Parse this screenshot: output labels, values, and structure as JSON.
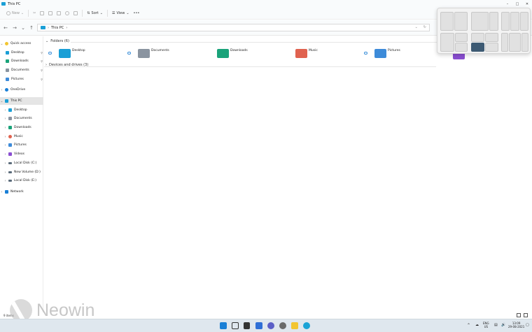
{
  "window": {
    "title": "This PC"
  },
  "toolbar": {
    "new_label": "New",
    "sort_label": "Sort",
    "view_label": "View",
    "more_label": "•••"
  },
  "address": {
    "path": "This PC"
  },
  "sidebar": {
    "items": [
      {
        "label": "Quick access",
        "icon_color": "#f2c531",
        "pinned": false
      },
      {
        "label": "Desktop",
        "icon_color": "#1a9fd6",
        "pinned": true
      },
      {
        "label": "Downloads",
        "icon_color": "#1aa37a",
        "pinned": true
      },
      {
        "label": "Documents",
        "icon_color": "#8a94a0",
        "pinned": true
      },
      {
        "label": "Pictures",
        "icon_color": "#3d8bd9",
        "pinned": true
      },
      {
        "label": "OneDrive",
        "icon_color": "#1a7fd6",
        "pinned": false
      },
      {
        "label": "This PC",
        "icon_color": "#1a9fd6",
        "pinned": false
      },
      {
        "label": "Desktop",
        "icon_color": "#1a9fd6",
        "pinned": false
      },
      {
        "label": "Documents",
        "icon_color": "#8a94a0",
        "pinned": false
      },
      {
        "label": "Downloads",
        "icon_color": "#1aa37a",
        "pinned": false
      },
      {
        "label": "Music",
        "icon_color": "#e0624f",
        "pinned": false
      },
      {
        "label": "Pictures",
        "icon_color": "#3d8bd9",
        "pinned": false
      },
      {
        "label": "Videos",
        "icon_color": "#8a4fd1",
        "pinned": false
      },
      {
        "label": "Local Disk (C:)",
        "icon_color": "#5a6b7a",
        "pinned": false
      },
      {
        "label": "New Volume (D:)",
        "icon_color": "#5a6b7a",
        "pinned": false
      },
      {
        "label": "Local Disk (E:)",
        "icon_color": "#5a6b7a",
        "pinned": false
      },
      {
        "label": "Network",
        "icon_color": "#1a7fd6",
        "pinned": false
      }
    ]
  },
  "content": {
    "folders_header": "Folders (6)",
    "drives_header": "Devices and drives (3)",
    "folders": [
      {
        "label": "Desktop",
        "color": "#1a9fd6"
      },
      {
        "label": "Documents",
        "color": "#8a94a0"
      },
      {
        "label": "Downloads",
        "color": "#1aa37a"
      },
      {
        "label": "Music",
        "color": "#e0624f"
      },
      {
        "label": "Pictures",
        "color": "#3d8bd9"
      }
    ]
  },
  "status": {
    "text": "9 items"
  },
  "tray": {
    "lang1": "ENG",
    "lang2": "US",
    "time": "13:09",
    "date": "29-08-2021"
  },
  "watermark": {
    "text": "Neowin"
  }
}
